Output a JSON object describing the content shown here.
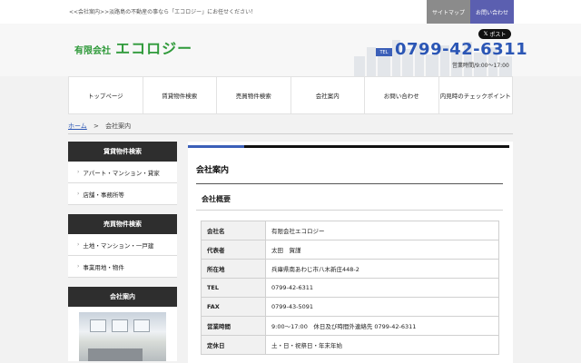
{
  "topbar": {
    "tagline": "<<会社案内>>淡路島の不動産の事なら「エコロジー」にお任せください！",
    "sitemap_label": "サイトマップ",
    "contact_label": "お問い合わせ"
  },
  "header": {
    "logo_small": "有限会社",
    "logo_big": "エコロジー",
    "x_post_label": "ポスト",
    "tel_badge": "TEL",
    "tel_number": "0799-42-6311",
    "hours": "営業時間/9:00～17:00"
  },
  "nav": [
    {
      "label": "トップページ"
    },
    {
      "label": "賃貸物件検索"
    },
    {
      "label": "売買物件検索"
    },
    {
      "label": "会社案内"
    },
    {
      "label": "お問い合わせ"
    },
    {
      "label": "内見時のチェックポイント"
    }
  ],
  "breadcrumb": {
    "home": "ホーム",
    "separator": ">",
    "current": "会社案内"
  },
  "sidebar": {
    "rent_heading": "賃貸物件検索",
    "rent_items": [
      {
        "label": "アパート・マンション・貸家"
      },
      {
        "label": "店舗・事務所等"
      }
    ],
    "sale_heading": "売買物件検索",
    "sale_items": [
      {
        "label": "土地・マンション・一戸建"
      },
      {
        "label": "事業用地・物件"
      }
    ],
    "company_heading": "会社案内"
  },
  "main": {
    "page_title": "会社案内",
    "section_title": "会社概要",
    "rows": [
      {
        "key": "会社名",
        "value": "有限会社エコロジー"
      },
      {
        "key": "代表者",
        "value": "太田　賀謹"
      },
      {
        "key": "所在地",
        "value": "兵庫県南あわじ市八木新庄448-2"
      },
      {
        "key": "TEL",
        "value": "0799-42-6311"
      },
      {
        "key": "FAX",
        "value": "0799-43-5091"
      },
      {
        "key": "営業時間",
        "value": "9:00～17:00　休日及び時間外連絡先 0799-42-6311"
      },
      {
        "key": "定休日",
        "value": "土・日・祝祭日・年末年始"
      }
    ]
  },
  "colors": {
    "logo_green": "#2f9a3a",
    "tel_blue": "#2b56b5",
    "accent_blue": "#3b5fb8",
    "sidebar_dark": "#2e2e2e"
  }
}
